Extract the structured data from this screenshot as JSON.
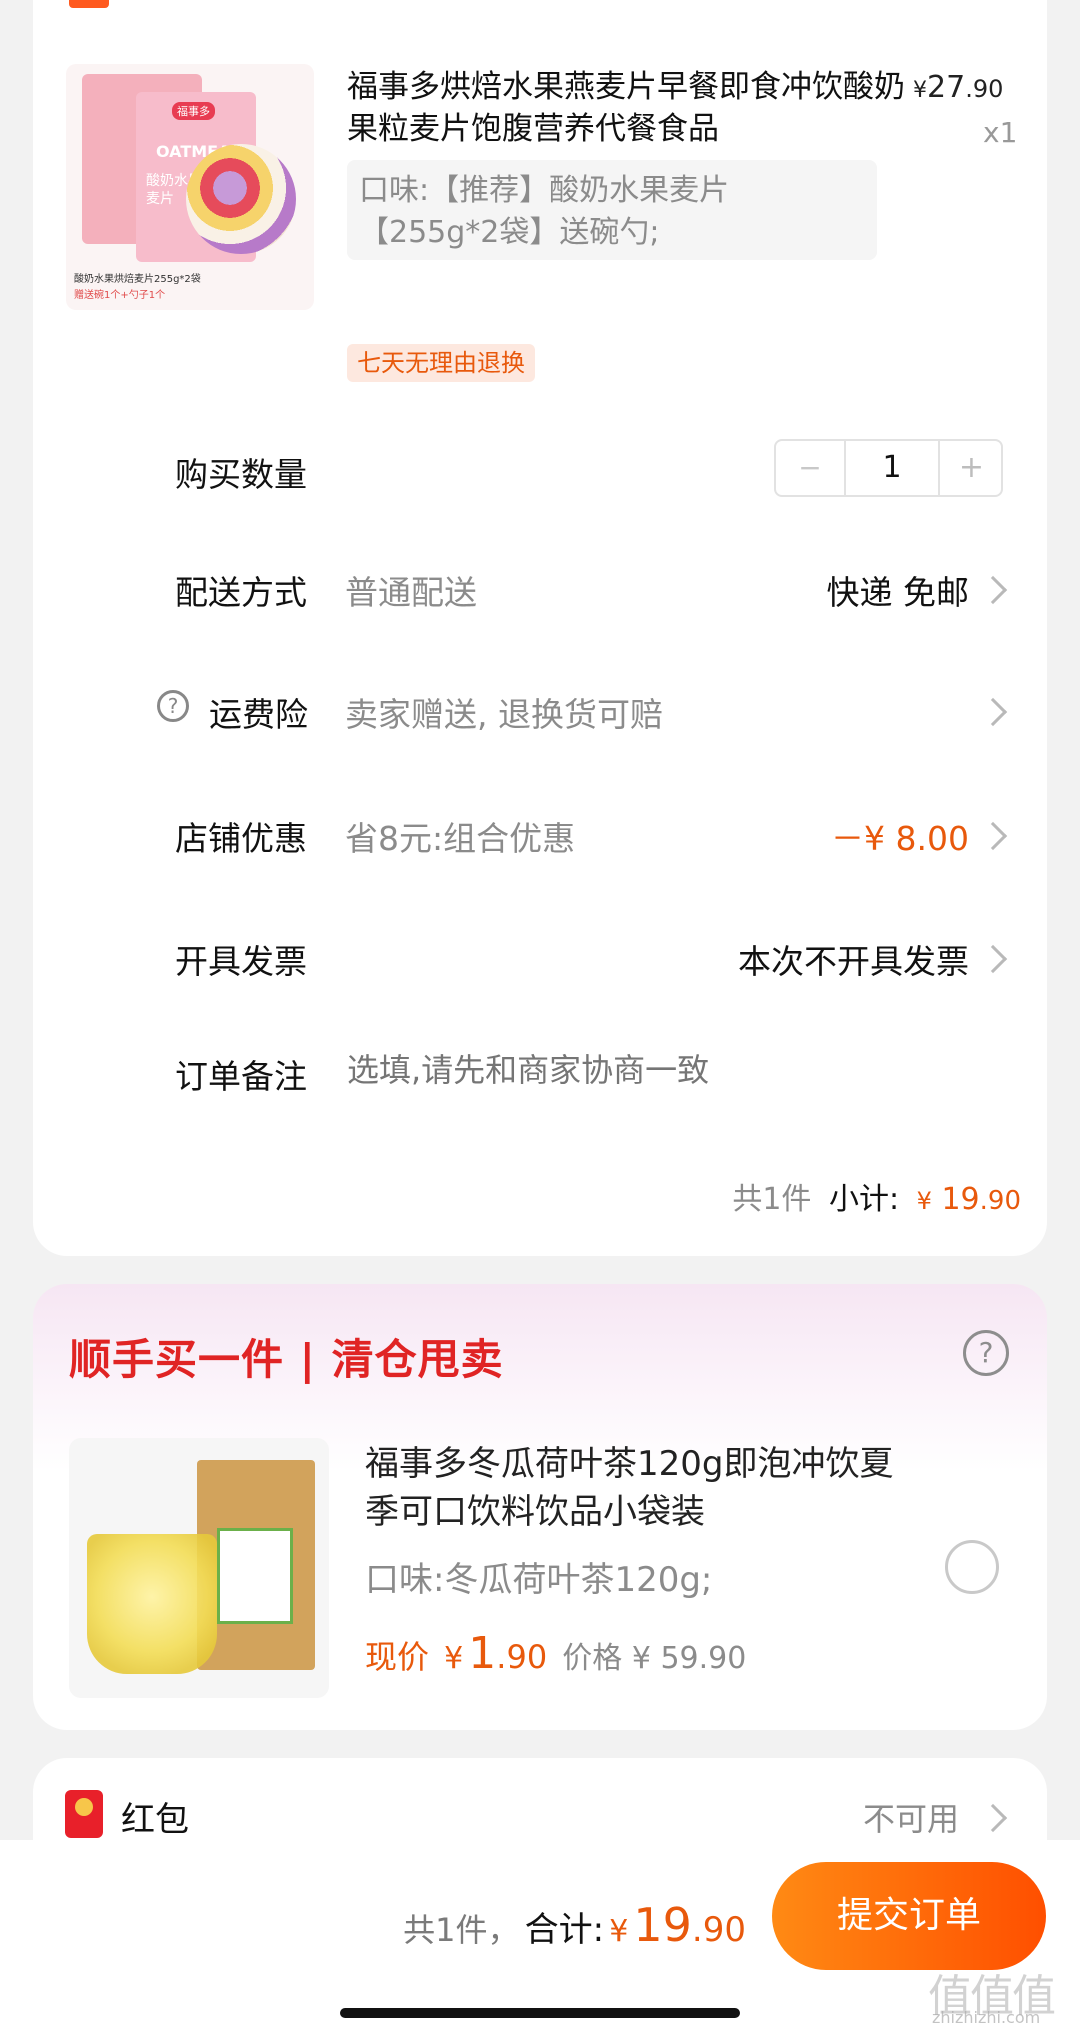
{
  "product": {
    "title": "福事多烘焙水果燕麦片早餐即食冲饮酸奶果粒麦片饱腹营养代餐食品",
    "price_symbol": "¥",
    "price_int": "27",
    "price_dec": ".90",
    "qty_label": "x1",
    "spec": "口味:【推荐】酸奶水果麦片【255g*2袋】送碗勺;",
    "return_tag": "七天无理由退换",
    "image": {
      "brand_badge": "福事多",
      "pack_text_en": "OATMEAL",
      "pack_text_cn": "酸奶水果燕麦片",
      "caption1": "酸奶水果烘焙麦片255g*2袋",
      "caption2": "赠送碗1个+勺子1个"
    }
  },
  "rows": {
    "quantity": {
      "label": "购买数量",
      "value": "1",
      "minus": "−",
      "plus": "+"
    },
    "delivery": {
      "label": "配送方式",
      "value": "普通配送",
      "right": "快递 免邮"
    },
    "insurance": {
      "label": "运费险",
      "value": "卖家赠送, 退换货可赔"
    },
    "discount": {
      "label": "店铺优惠",
      "value": "省8元:组合优惠",
      "right": "－¥ 8.00"
    },
    "invoice": {
      "label": "开具发票",
      "right": "本次不开具发票"
    },
    "note": {
      "label": "订单备注",
      "placeholder": "选填,请先和商家协商一致"
    }
  },
  "subtotal": {
    "count": "共1件",
    "label": "小计:",
    "symbol": "¥",
    "int": "19",
    "dec": ".90"
  },
  "addon": {
    "header": "顺手买一件 | 清仓甩卖",
    "title": "福事多冬瓜荷叶茶120g即泡冲饮夏季可口饮料饮品小袋装",
    "spec": "口味:冬瓜荷叶茶120g;",
    "now_label": "现价",
    "now_symbol": "¥",
    "now_int": "1",
    "now_dec": ".90",
    "orig": "价格 ¥ 59.90"
  },
  "redpacket": {
    "label": "红包",
    "value": "不可用"
  },
  "footer": {
    "count": "共1件，",
    "total_label": "合计:",
    "symbol": "¥",
    "int": "19",
    "dec": ".90",
    "submit": "提交订单",
    "watermark": "值值值",
    "watermark_url": "zhizhizhi.com"
  },
  "colors": {
    "accent": "#e8590c",
    "submit_start": "#ff8a14",
    "submit_end": "#ff4f00",
    "promo_red": "#e02424",
    "tag_bg": "#fde8df"
  }
}
